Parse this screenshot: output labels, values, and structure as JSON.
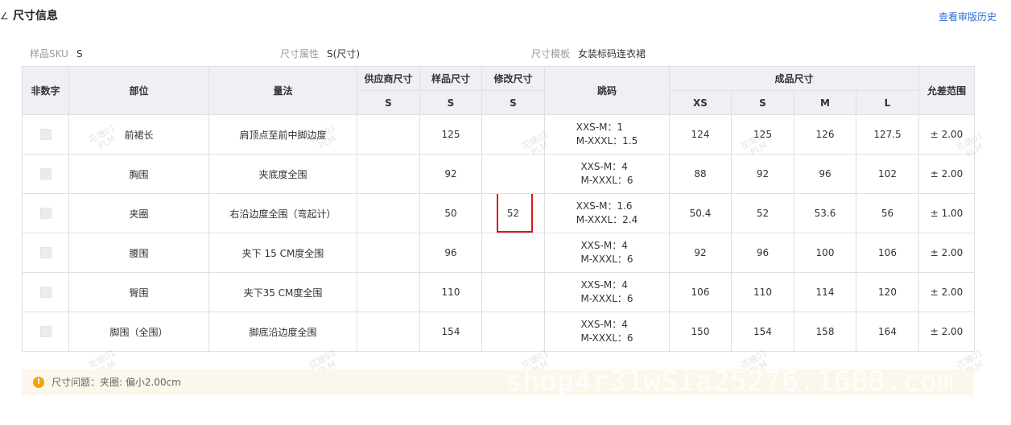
{
  "section": {
    "title": "尺寸信息",
    "history_link": "查看审版历史"
  },
  "meta": {
    "sku_label": "样品SKU",
    "sku_value": "S",
    "attr_label": "尺寸属性",
    "attr_value": "S(尺寸)",
    "template_label": "尺寸模板",
    "template_value": "女装标码连衣裙"
  },
  "table": {
    "headers": {
      "non_numeric": "非数字",
      "part": "部位",
      "method": "量法",
      "supplier": "供应商尺寸",
      "sample": "样品尺寸",
      "modified": "修改尺寸",
      "grading": "跳码",
      "finished": "成品尺寸",
      "tolerance": "允差范围"
    },
    "sub_headers": {
      "supplier": "S",
      "sample": "S",
      "modified": "S",
      "xs": "XS",
      "s": "S",
      "m": "M",
      "l": "L"
    },
    "rows": [
      {
        "part": "前裙长",
        "method": "肩顶点至前中脚边度",
        "supplier": "",
        "sample": "125",
        "modified": "",
        "grading": "XXS-M：1\nM-XXXL：1.5",
        "xs": "124",
        "s": "125",
        "m": "126",
        "l": "127.5",
        "tol": "± 2.00"
      },
      {
        "part": "胸围",
        "method": "夹底度全围",
        "supplier": "",
        "sample": "92",
        "modified": "",
        "grading": "XXS-M：4\nM-XXXL：6",
        "xs": "88",
        "s": "92",
        "m": "96",
        "l": "102",
        "tol": "± 2.00"
      },
      {
        "part": "夹圈",
        "method": "右沿边度全围（弯起计）",
        "supplier": "",
        "sample": "50",
        "modified": "52",
        "grading": "XXS-M：1.6\nM-XXXL：2.4",
        "xs": "50.4",
        "s": "52",
        "m": "53.6",
        "l": "56",
        "tol": "± 1.00"
      },
      {
        "part": "腰围",
        "method": "夹下 15 CM度全围",
        "supplier": "",
        "sample": "96",
        "modified": "",
        "grading": "XXS-M：4\nM-XXXL：6",
        "xs": "92",
        "s": "96",
        "m": "100",
        "l": "106",
        "tol": "± 2.00"
      },
      {
        "part": "臀围",
        "method": "夹下35 CM度全围",
        "supplier": "",
        "sample": "110",
        "modified": "",
        "grading": "XXS-M：4\nM-XXXL：6",
        "xs": "106",
        "s": "110",
        "m": "114",
        "l": "120",
        "tol": "± 2.00"
      },
      {
        "part": "脚围（全围）",
        "method": "脚底沿边度全围",
        "supplier": "",
        "sample": "154",
        "modified": "",
        "grading": "XXS-M：4\nM-XXXL：6",
        "xs": "150",
        "s": "154",
        "m": "158",
        "l": "164",
        "tol": "± 2.00"
      }
    ]
  },
  "warning": {
    "text": "尺寸问题：夹圈: 偏小2.00cm"
  },
  "watermark": {
    "text": "shop4r31wSia25276.1688.com"
  },
  "stamp": {
    "line1": "花塘01",
    "line2": "PLM"
  },
  "colors": {
    "accent": "#2f6fd8",
    "highlight": "#d9191c",
    "warning_bg": "#fdf6ec",
    "warning_icon": "#f2a30f",
    "header_bg": "#eef0f4"
  },
  "icons": {
    "collapse": "chevron-icon",
    "warning": "warning-icon"
  }
}
